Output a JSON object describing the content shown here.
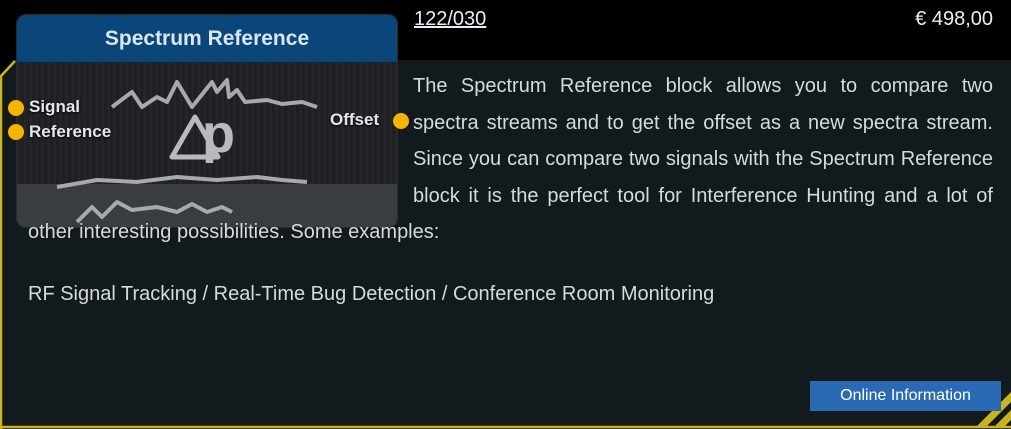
{
  "block": {
    "title": "Spectrum Reference",
    "symbol": "Δp",
    "inputs": [
      "Signal",
      "Reference"
    ],
    "output": "Offset"
  },
  "product": {
    "sku": "122/030",
    "price": "€ 498,00"
  },
  "description": "The Spectrum Reference block allows you to compare two spectra streams and to get the offset as a new spectra stream. Since you can compare two signals with the Spectrum Reference block it is the perfect tool for Interference Hunting and a lot of other interesting possibilities. Some examples:",
  "examples": "RF Signal Tracking / Real-Time Bug Detection / Conference Room Monitoring",
  "online_button": "Online Information",
  "colors": {
    "panel_background": "#131a1d",
    "panel_border": "#c8b41e",
    "header_blue": "#0a4679",
    "port_dot": "#f6b400",
    "button_blue": "#2a6ab5"
  }
}
